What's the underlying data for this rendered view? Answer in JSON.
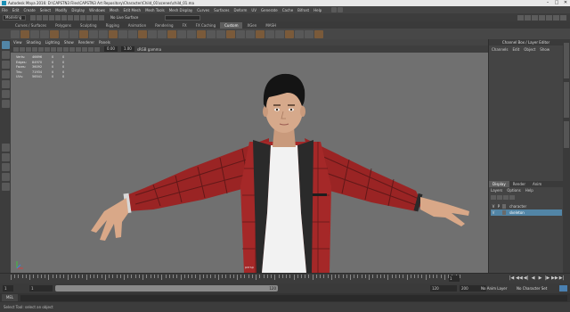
{
  "title_bar": {
    "title": "Autodesk Maya 2016: D:\\CAPSTN3 Files\\CAPSTN3 Art Repository\\Character\\Child_01\\scenes\\child_01.ma",
    "minimize": "–",
    "maximize": "□",
    "close": "✕"
  },
  "menubar": [
    "File",
    "Edit",
    "Create",
    "Select",
    "Modify",
    "Display",
    "Windows",
    "Mesh",
    "Edit Mesh",
    "Mesh Tools",
    "Mesh Display",
    "Curves",
    "Surfaces",
    "Deform",
    "UV",
    "Generate",
    "Cache",
    "Bifrost",
    "Help"
  ],
  "status_line": {
    "menuset": "Modeling",
    "live_surface": "No Live Surface"
  },
  "shelf_tabs": [
    "Curves / Surfaces",
    "Polygons",
    "Sculpting",
    "Rigging",
    "Animation",
    "Rendering",
    "FX",
    "FX Caching",
    "Custom",
    "XGen",
    "MASH"
  ],
  "shelf_active_tab": "Custom",
  "panel_menu": [
    "View",
    "Shading",
    "Lighting",
    "Show",
    "Renderer",
    "Panels"
  ],
  "panel_toolbar": {
    "exposure": "0.00",
    "gamma": "1.00",
    "colorspace": "sRGB gamma"
  },
  "hud": {
    "rows": [
      {
        "label": "Verts:",
        "v1": "46696",
        "v2": "0",
        "v3": "0"
      },
      {
        "label": "Edges:",
        "v1": "84970",
        "v2": "0",
        "v3": "0"
      },
      {
        "label": "Faces:",
        "v1": "36092",
        "v2": "0",
        "v3": "0"
      },
      {
        "label": "Tris:",
        "v1": "71934",
        "v2": "0",
        "v3": "0"
      },
      {
        "label": "UVs:",
        "v1": "56541",
        "v2": "0",
        "v3": "0"
      }
    ]
  },
  "camera_label": "persp",
  "channel_box": {
    "title": "Channel Box / Layer Editor",
    "menu": [
      "Channels",
      "Edit",
      "Object",
      "Show"
    ]
  },
  "layer_editor": {
    "tabs": [
      "Display",
      "Render",
      "Anim"
    ],
    "menu": [
      "Layers",
      "Options",
      "Help"
    ],
    "layers": [
      {
        "v": "V",
        "p": "P",
        "name": "character",
        "selected": false
      },
      {
        "v": "V",
        "p": "",
        "name": "skeleton",
        "selected": true
      }
    ]
  },
  "time_slider": {
    "current_frame": "1",
    "playback": [
      "|◀",
      "◀◀",
      "◀|",
      "◀",
      "▶",
      "|▶",
      "▶▶",
      "▶|"
    ]
  },
  "range_slider": {
    "start": "1",
    "inner_start": "1",
    "inner_end": "120",
    "end_a": "120",
    "end_b": "200",
    "anim_layer": "No Anim Layer",
    "char_set": "No Character Set"
  },
  "command_line": {
    "lang": "MEL"
  },
  "help_line": "Select Tool: select an object",
  "colors": {
    "selection": "#5285a6",
    "viewport_bg": "#707070"
  }
}
